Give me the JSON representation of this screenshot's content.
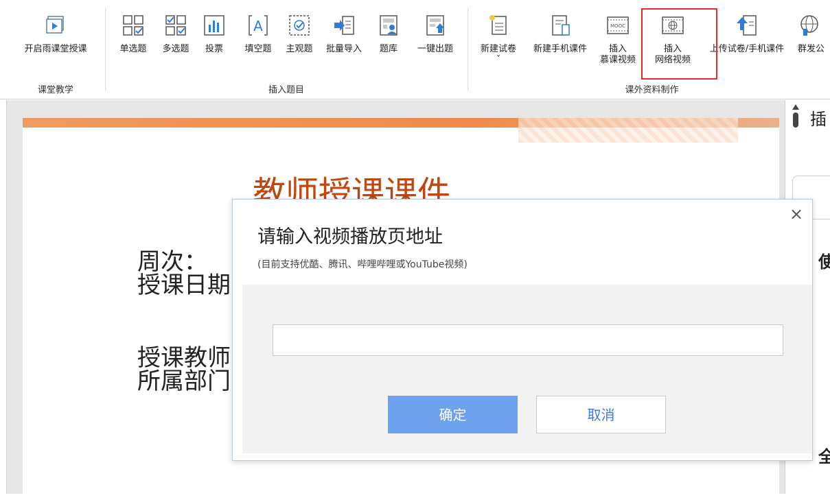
{
  "ribbon": {
    "buttons": [
      {
        "label": "开启雨课堂授课"
      },
      {
        "label": "单选题"
      },
      {
        "label": "多选题"
      },
      {
        "label": "投票"
      },
      {
        "label": "填空题"
      },
      {
        "label": "主观题"
      },
      {
        "label": "批量导入"
      },
      {
        "label": "题库"
      },
      {
        "label": "一键出题"
      },
      {
        "label": "新建试卷",
        "chevron": "ˇ"
      },
      {
        "label": "新建手机课件"
      },
      {
        "label": "插入",
        "label2": "慕课视频"
      },
      {
        "label": "插入",
        "label2": "网络视频"
      },
      {
        "label": "上传试卷/手机课件"
      },
      {
        "label": "群发公"
      }
    ],
    "groups": {
      "classroom": "课堂教学",
      "insert_questions": "插入题目",
      "materials": "课外资料制作"
    },
    "mooc_text": "MOOC"
  },
  "slide": {
    "title": "教师授课课件",
    "line1": "周次：",
    "line2": "授课日期",
    "line3": "授课教师",
    "line4": "所属部门"
  },
  "sidepanel": {
    "glyph_top": "插",
    "glyph_mid": "使",
    "glyph_bottom": "全"
  },
  "dialog": {
    "title": "请输入视频播放页地址",
    "subtitle": "(目前支持优酷、腾讯、哔哩哔哩或YouTube视频)",
    "input_value": "",
    "ok_label": "确定",
    "cancel_label": "取消",
    "close_symbol": "×"
  },
  "colors": {
    "accent_red": "#e42b2b",
    "ok_button": "#6ea2ef",
    "slide_title": "#c0470f"
  }
}
